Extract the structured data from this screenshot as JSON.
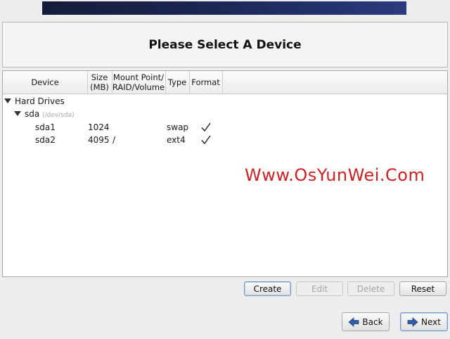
{
  "header": {
    "title": "Please Select A Device"
  },
  "table": {
    "columns": [
      "Device",
      "Size\n(MB)",
      "Mount Point/\nRAID/Volume",
      "Type",
      "Format"
    ],
    "groups": [
      {
        "label": "Hard Drives",
        "disks": [
          {
            "name": "sda",
            "path": "(/dev/sda)",
            "partitions": [
              {
                "device": "sda1",
                "size": "1024",
                "mount": "",
                "type": "swap",
                "format": "✓"
              },
              {
                "device": "sda2",
                "size": "4095",
                "mount": "/",
                "type": "ext4",
                "format": "✓"
              }
            ]
          }
        ]
      }
    ]
  },
  "watermark": "Www.OsYunWei.Com",
  "actions": {
    "create": "Create",
    "edit": "Edit",
    "delete": "Delete",
    "reset": "Reset"
  },
  "nav": {
    "back": "Back",
    "next": "Next"
  },
  "colors": {
    "banner": "#1a2550",
    "watermark": "#d31f1f",
    "arrow": "#2f5ea8"
  }
}
